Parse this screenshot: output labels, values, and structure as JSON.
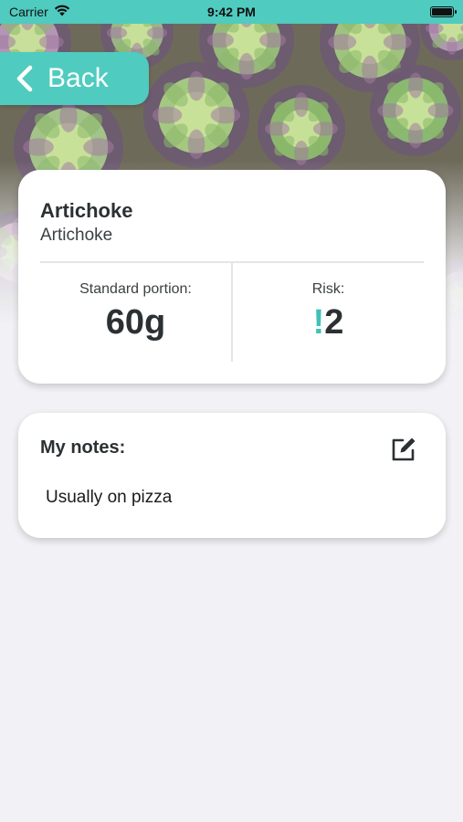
{
  "status_bar": {
    "carrier": "Carrier",
    "time": "9:42 PM",
    "icons": [
      "wifi-icon",
      "battery-icon"
    ]
  },
  "nav": {
    "back_label": "Back",
    "back_icon": "chevron-left-icon"
  },
  "food": {
    "name": "Artichoke",
    "subname": "Artichoke",
    "portion_label": "Standard portion:",
    "portion_value": "60g",
    "risk_label": "Risk:",
    "risk_mark": "!",
    "risk_value": "2"
  },
  "notes": {
    "title": "My notes:",
    "text": "Usually on pizza",
    "edit_icon": "edit-icon"
  },
  "colors": {
    "accent": "#4fcbbf",
    "risk": "#3fc2b6",
    "background": "#f2f2f6",
    "text": "#2b3133"
  }
}
